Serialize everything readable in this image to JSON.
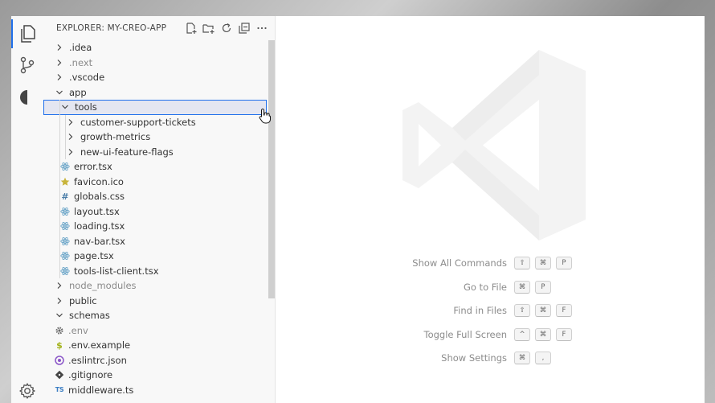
{
  "explorer": {
    "title": "EXPLORER: MY-CREO-APP",
    "tree": [
      {
        "label": ".idea",
        "type": "folder",
        "depth": 0,
        "expanded": false,
        "muted": false
      },
      {
        "label": ".next",
        "type": "folder",
        "depth": 0,
        "expanded": false,
        "muted": true
      },
      {
        "label": ".vscode",
        "type": "folder",
        "depth": 0,
        "expanded": false,
        "muted": false
      },
      {
        "label": "app",
        "type": "folder",
        "depth": 0,
        "expanded": true,
        "muted": false
      },
      {
        "label": "tools",
        "type": "folder",
        "depth": 1,
        "expanded": true,
        "selected": true,
        "muted": false
      },
      {
        "label": "customer-support-tickets",
        "type": "folder",
        "depth": 2,
        "expanded": false,
        "muted": false
      },
      {
        "label": "growth-metrics",
        "type": "folder",
        "depth": 2,
        "expanded": false,
        "muted": false
      },
      {
        "label": "new-ui-feature-flags",
        "type": "folder",
        "depth": 2,
        "expanded": false,
        "muted": false
      },
      {
        "label": "error.tsx",
        "type": "file",
        "icon": "react-icon",
        "depth": 1,
        "muted": false
      },
      {
        "label": "favicon.ico",
        "type": "file",
        "icon": "star-icon",
        "depth": 1,
        "muted": false
      },
      {
        "label": "globals.css",
        "type": "file",
        "icon": "hash-icon",
        "depth": 1,
        "muted": false
      },
      {
        "label": "layout.tsx",
        "type": "file",
        "icon": "react-icon",
        "depth": 1,
        "muted": false
      },
      {
        "label": "loading.tsx",
        "type": "file",
        "icon": "react-icon",
        "depth": 1,
        "muted": false
      },
      {
        "label": "nav-bar.tsx",
        "type": "file",
        "icon": "react-icon",
        "depth": 1,
        "muted": false
      },
      {
        "label": "page.tsx",
        "type": "file",
        "icon": "react-icon",
        "depth": 1,
        "muted": false
      },
      {
        "label": "tools-list-client.tsx",
        "type": "file",
        "icon": "react-icon",
        "depth": 1,
        "muted": false
      },
      {
        "label": "node_modules",
        "type": "folder",
        "depth": 0,
        "expanded": false,
        "muted": true
      },
      {
        "label": "public",
        "type": "folder",
        "depth": 0,
        "expanded": false,
        "muted": false
      },
      {
        "label": "schemas",
        "type": "folder",
        "depth": 0,
        "expanded": true,
        "muted": false
      },
      {
        "label": ".env",
        "type": "file",
        "icon": "gear-icon",
        "depth": 0,
        "muted": true
      },
      {
        "label": ".env.example",
        "type": "file",
        "icon": "dollar-icon",
        "depth": 0,
        "muted": false
      },
      {
        "label": ".eslintrc.json",
        "type": "file",
        "icon": "eslint-icon",
        "depth": 0,
        "muted": false
      },
      {
        "label": ".gitignore",
        "type": "file",
        "icon": "git-icon",
        "depth": 0,
        "muted": false
      },
      {
        "label": "middleware.ts",
        "type": "file",
        "icon": "ts-icon",
        "icon_text": "TS",
        "depth": 0,
        "muted": false
      }
    ]
  },
  "shortcuts": [
    {
      "label": "Show All Commands",
      "keys": [
        "⇧",
        "⌘",
        "P"
      ]
    },
    {
      "label": "Go to File",
      "keys": [
        "⌘",
        "P"
      ]
    },
    {
      "label": "Find in Files",
      "keys": [
        "⇧",
        "⌘",
        "F"
      ]
    },
    {
      "label": "Toggle Full Screen",
      "keys": [
        "^",
        "⌘",
        "F"
      ]
    },
    {
      "label": "Show Settings",
      "keys": [
        "⌘",
        ","
      ]
    }
  ],
  "colors": {
    "accent": "#1f6feb",
    "react": "#6ea7c9",
    "star": "#c8b43b",
    "hash": "#4a7da8",
    "dollar": "#a2b21a",
    "eslint": "#8a55c8",
    "git": "#444444",
    "ts": "#3d7fc4"
  }
}
